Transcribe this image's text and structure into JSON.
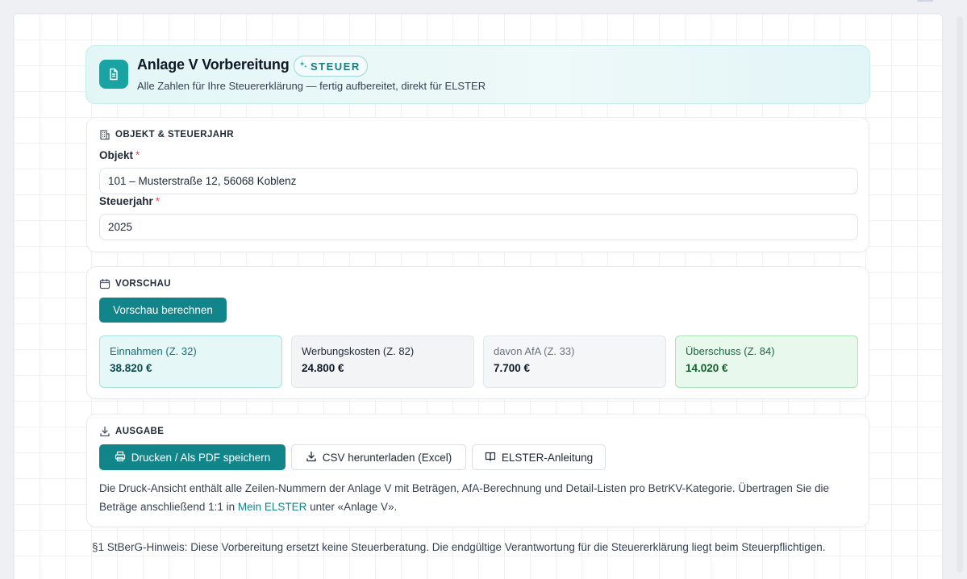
{
  "header": {
    "title": "Anlage V Vorbereitung",
    "badge": "STEUER",
    "subtitle": "Alle Zahlen für Ihre Steuererklärung — fertig aufbereitet, direkt für ELSTER"
  },
  "objekt_section": {
    "heading": "OBJEKT & STEUERJAHR",
    "objekt_label": "Objekt",
    "objekt_value": "101 – Musterstraße 12, 56068 Koblenz",
    "steuerjahr_label": "Steuerjahr",
    "steuerjahr_value": "2025",
    "required_mark": "*"
  },
  "vorschau_section": {
    "heading": "VORSCHAU",
    "button": "Vorschau berechnen",
    "stats": [
      {
        "label": "Einnahmen (Z. 32)",
        "value": "38.820 €"
      },
      {
        "label": "Werbungskosten (Z. 82)",
        "value": "24.800 €"
      },
      {
        "label": "davon AfA (Z. 33)",
        "value": "7.700 €"
      },
      {
        "label": "Überschuss (Z. 84)",
        "value": "14.020 €"
      }
    ]
  },
  "ausgabe_section": {
    "heading": "AUSGABE",
    "print_button": "Drucken / Als PDF speichern",
    "csv_button": "CSV herunterladen (Excel)",
    "elster_button": "ELSTER-Anleitung",
    "desc_before": "Die Druck-Ansicht enthält alle Zeilen-Nummern der Anlage V mit Beträgen, AfA-Berechnung und Detail-Listen pro BetrKV-Kategorie. Übertragen Sie die Beträge anschließend 1:1 in ",
    "desc_link": "Mein ELSTER",
    "desc_after": " unter «Anlage V»."
  },
  "disclaimer": "§1 StBerG-Hinweis: Diese Vorbereitung ersetzt keine Steuerberatung. Die endgültige Verantwortung für die Steuererklärung liegt beim Steuerpflichtigen.",
  "colors": {
    "accent": "#12858a",
    "teal_icon": "#1aa3a3",
    "required": "#e25555",
    "positive": "#135e2f"
  },
  "icons": {
    "header": "document-icon",
    "badge": "sparkle-icon",
    "objekt": "building-icon",
    "vorschau": "calendar-icon",
    "ausgabe": "download-icon",
    "print": "printer-icon",
    "csv": "download-icon",
    "elster": "book-icon"
  }
}
